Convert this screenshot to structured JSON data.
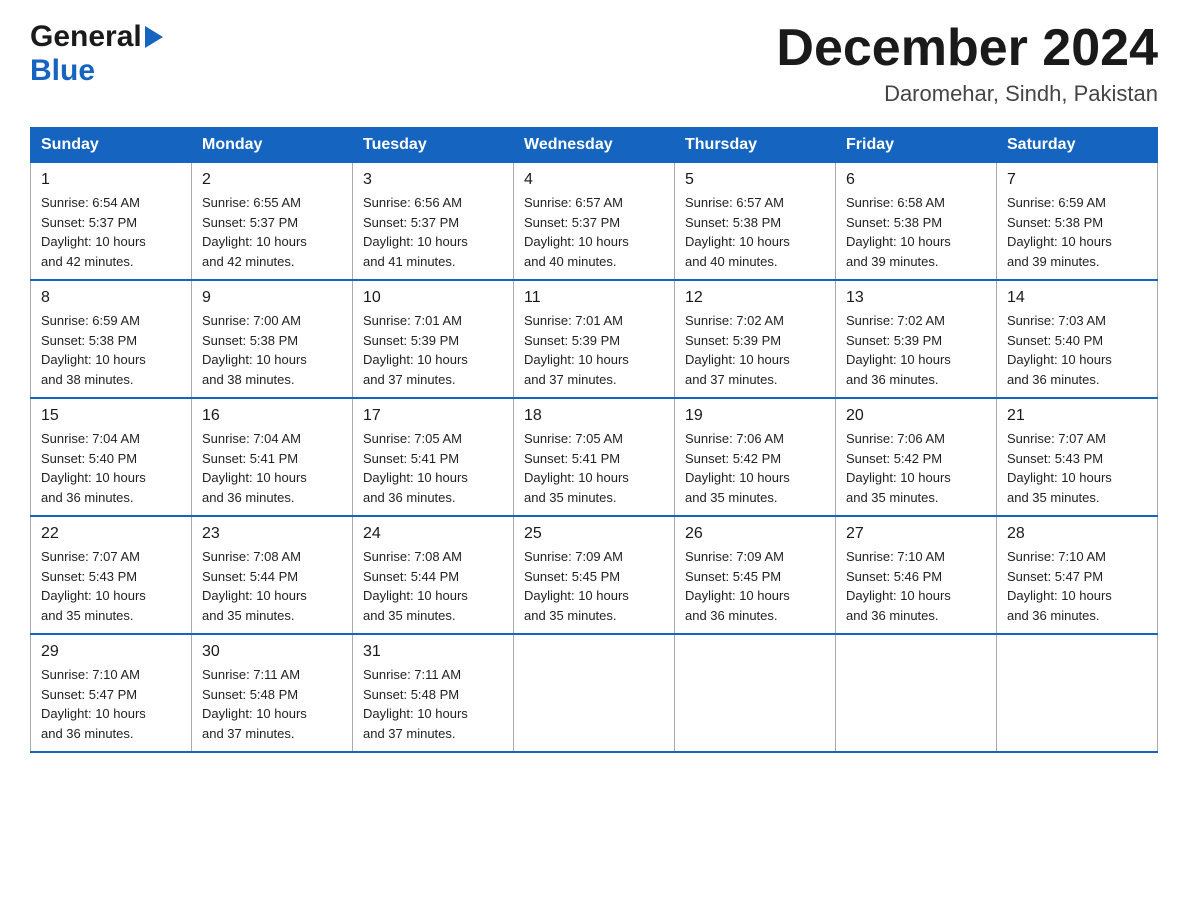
{
  "header": {
    "logo_general": "General",
    "logo_blue": "Blue",
    "month_title": "December 2024",
    "location": "Daromehar, Sindh, Pakistan"
  },
  "calendar": {
    "days_of_week": [
      "Sunday",
      "Monday",
      "Tuesday",
      "Wednesday",
      "Thursday",
      "Friday",
      "Saturday"
    ],
    "weeks": [
      [
        {
          "day": "1",
          "sunrise": "6:54 AM",
          "sunset": "5:37 PM",
          "daylight": "10 hours and 42 minutes."
        },
        {
          "day": "2",
          "sunrise": "6:55 AM",
          "sunset": "5:37 PM",
          "daylight": "10 hours and 42 minutes."
        },
        {
          "day": "3",
          "sunrise": "6:56 AM",
          "sunset": "5:37 PM",
          "daylight": "10 hours and 41 minutes."
        },
        {
          "day": "4",
          "sunrise": "6:57 AM",
          "sunset": "5:37 PM",
          "daylight": "10 hours and 40 minutes."
        },
        {
          "day": "5",
          "sunrise": "6:57 AM",
          "sunset": "5:38 PM",
          "daylight": "10 hours and 40 minutes."
        },
        {
          "day": "6",
          "sunrise": "6:58 AM",
          "sunset": "5:38 PM",
          "daylight": "10 hours and 39 minutes."
        },
        {
          "day": "7",
          "sunrise": "6:59 AM",
          "sunset": "5:38 PM",
          "daylight": "10 hours and 39 minutes."
        }
      ],
      [
        {
          "day": "8",
          "sunrise": "6:59 AM",
          "sunset": "5:38 PM",
          "daylight": "10 hours and 38 minutes."
        },
        {
          "day": "9",
          "sunrise": "7:00 AM",
          "sunset": "5:38 PM",
          "daylight": "10 hours and 38 minutes."
        },
        {
          "day": "10",
          "sunrise": "7:01 AM",
          "sunset": "5:39 PM",
          "daylight": "10 hours and 37 minutes."
        },
        {
          "day": "11",
          "sunrise": "7:01 AM",
          "sunset": "5:39 PM",
          "daylight": "10 hours and 37 minutes."
        },
        {
          "day": "12",
          "sunrise": "7:02 AM",
          "sunset": "5:39 PM",
          "daylight": "10 hours and 37 minutes."
        },
        {
          "day": "13",
          "sunrise": "7:02 AM",
          "sunset": "5:39 PM",
          "daylight": "10 hours and 36 minutes."
        },
        {
          "day": "14",
          "sunrise": "7:03 AM",
          "sunset": "5:40 PM",
          "daylight": "10 hours and 36 minutes."
        }
      ],
      [
        {
          "day": "15",
          "sunrise": "7:04 AM",
          "sunset": "5:40 PM",
          "daylight": "10 hours and 36 minutes."
        },
        {
          "day": "16",
          "sunrise": "7:04 AM",
          "sunset": "5:41 PM",
          "daylight": "10 hours and 36 minutes."
        },
        {
          "day": "17",
          "sunrise": "7:05 AM",
          "sunset": "5:41 PM",
          "daylight": "10 hours and 36 minutes."
        },
        {
          "day": "18",
          "sunrise": "7:05 AM",
          "sunset": "5:41 PM",
          "daylight": "10 hours and 35 minutes."
        },
        {
          "day": "19",
          "sunrise": "7:06 AM",
          "sunset": "5:42 PM",
          "daylight": "10 hours and 35 minutes."
        },
        {
          "day": "20",
          "sunrise": "7:06 AM",
          "sunset": "5:42 PM",
          "daylight": "10 hours and 35 minutes."
        },
        {
          "day": "21",
          "sunrise": "7:07 AM",
          "sunset": "5:43 PM",
          "daylight": "10 hours and 35 minutes."
        }
      ],
      [
        {
          "day": "22",
          "sunrise": "7:07 AM",
          "sunset": "5:43 PM",
          "daylight": "10 hours and 35 minutes."
        },
        {
          "day": "23",
          "sunrise": "7:08 AM",
          "sunset": "5:44 PM",
          "daylight": "10 hours and 35 minutes."
        },
        {
          "day": "24",
          "sunrise": "7:08 AM",
          "sunset": "5:44 PM",
          "daylight": "10 hours and 35 minutes."
        },
        {
          "day": "25",
          "sunrise": "7:09 AM",
          "sunset": "5:45 PM",
          "daylight": "10 hours and 35 minutes."
        },
        {
          "day": "26",
          "sunrise": "7:09 AM",
          "sunset": "5:45 PM",
          "daylight": "10 hours and 36 minutes."
        },
        {
          "day": "27",
          "sunrise": "7:10 AM",
          "sunset": "5:46 PM",
          "daylight": "10 hours and 36 minutes."
        },
        {
          "day": "28",
          "sunrise": "7:10 AM",
          "sunset": "5:47 PM",
          "daylight": "10 hours and 36 minutes."
        }
      ],
      [
        {
          "day": "29",
          "sunrise": "7:10 AM",
          "sunset": "5:47 PM",
          "daylight": "10 hours and 36 minutes."
        },
        {
          "day": "30",
          "sunrise": "7:11 AM",
          "sunset": "5:48 PM",
          "daylight": "10 hours and 37 minutes."
        },
        {
          "day": "31",
          "sunrise": "7:11 AM",
          "sunset": "5:48 PM",
          "daylight": "10 hours and 37 minutes."
        },
        null,
        null,
        null,
        null
      ]
    ],
    "labels": {
      "sunrise": "Sunrise:",
      "sunset": "Sunset:",
      "daylight": "Daylight:"
    }
  }
}
